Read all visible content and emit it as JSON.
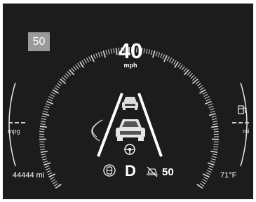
{
  "speed_limit": "50",
  "speed": {
    "value": "40",
    "unit": "mph"
  },
  "left_gauge": {
    "label": "mpg"
  },
  "right_gauge": {
    "label": "mi"
  },
  "odometer": "44444 mi",
  "gear": "D",
  "acc_set_speed": "50",
  "outside_temp": "71°F",
  "icons": [
    "fuel-pump-icon",
    "seatbelt-icon",
    "adaptive-cruise-icon",
    "steering-wheel-icon",
    "lead-vehicle-icon",
    "ego-vehicle-icon"
  ],
  "colors": {
    "background": "#1c1c1c",
    "foreground": "#ffffff",
    "speed_limit_box": "#9a9a9a"
  }
}
